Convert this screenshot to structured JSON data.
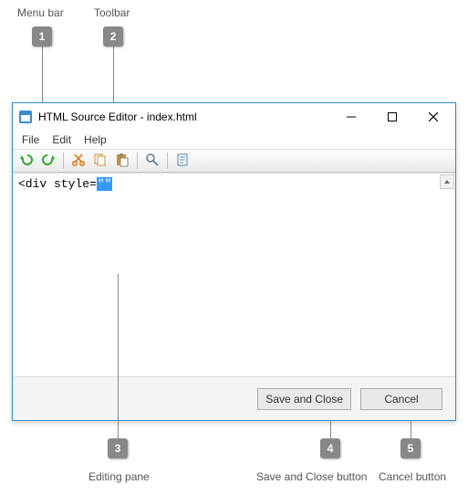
{
  "callouts": {
    "top1": {
      "num": "1",
      "label": "Menu bar"
    },
    "top2": {
      "num": "2",
      "label": "Toolbar"
    },
    "bot3": {
      "num": "3",
      "label": "Editing pane"
    },
    "bot4": {
      "num": "4",
      "label": "Save and Close button"
    },
    "bot5": {
      "num": "5",
      "label": "Cancel button"
    }
  },
  "window": {
    "title": "HTML Source Editor - index.html",
    "controls": {
      "min": "—",
      "max": "▢",
      "close": "✕"
    }
  },
  "menubar": {
    "file": "File",
    "edit": "Edit",
    "help": "Help"
  },
  "toolbar": {
    "undo": "undo",
    "redo": "redo",
    "cut": "cut",
    "copy": "copy",
    "paste": "paste",
    "find": "find",
    "word_wrap": "word-wrap"
  },
  "editor": {
    "content_prefix": "<div style=",
    "content_selection": "\"\""
  },
  "buttons": {
    "save": "Save and Close",
    "cancel": "Cancel"
  }
}
